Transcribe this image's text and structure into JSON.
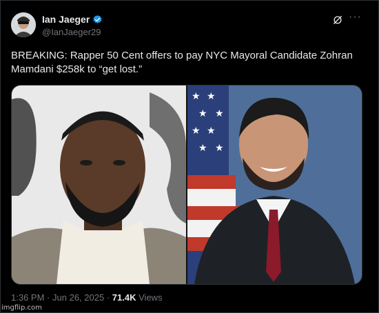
{
  "author": {
    "name": "Ian Jaeger",
    "handle": "@IanJaeger29",
    "verified": true
  },
  "tweet": {
    "text": "BREAKING: Rapper 50 Cent offers to pay NYC Mayoral Candidate Zohran Mamdani $258k to “get lost.”"
  },
  "meta": {
    "time": "1:36 PM",
    "separator": "·",
    "date": "Jun 26, 2025",
    "views_count": "71.4K",
    "views_label": "Views"
  },
  "watermark": "imgflip.com",
  "icons": {
    "verified": "verified-badge-icon",
    "grok": "grok-icon",
    "more": "more-icon"
  },
  "colors": {
    "background": "#000000",
    "text": "#e7e9ea",
    "muted": "#71767b",
    "verified": "#1d9bf0",
    "border": "#2f3336"
  }
}
